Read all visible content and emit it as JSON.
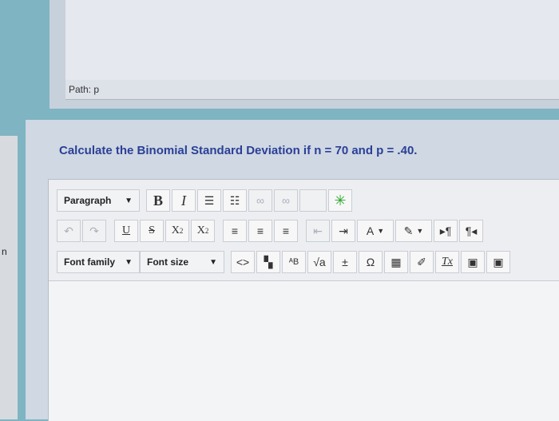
{
  "sidebar": {
    "letter": "n"
  },
  "path_bar": {
    "label": "Path: p"
  },
  "question": {
    "text": "Calculate the Binomial Standard Deviation if n = 70 and p = .40."
  },
  "toolbar": {
    "paragraph": "Paragraph",
    "bold": "B",
    "italic": "I",
    "underline": "U",
    "strike": "S",
    "subscript_base": "X",
    "subscript_mark": "2",
    "superscript_base": "X",
    "superscript_mark": "2",
    "font_family": "Font family",
    "font_size": "Font size",
    "code": "<>",
    "align_left": "≡",
    "align_center": "≡",
    "align_right": "≡",
    "text_color": "A",
    "ltr": "▸¶",
    "rtl": "¶◂",
    "omega": "Ω",
    "clear_format": "Tx",
    "sqrt": "√a",
    "add": "±"
  }
}
